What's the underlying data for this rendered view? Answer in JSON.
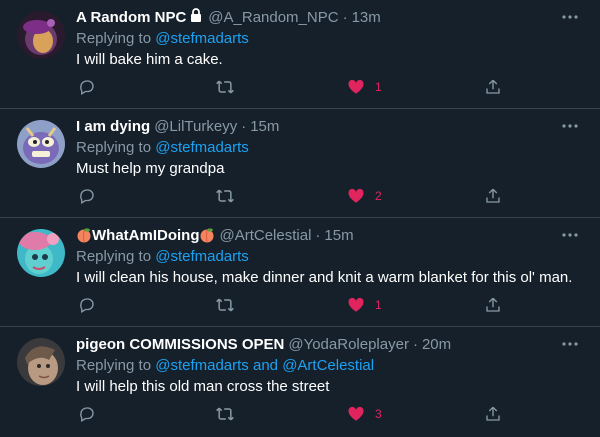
{
  "colors": {
    "background": "#15202b",
    "divider": "#38444d",
    "secondary_text": "#8899a6",
    "mention": "#1da1f2",
    "like_active": "#e0245e"
  },
  "replies": [
    {
      "display_name": "A Random NPC",
      "name_icon": "lock-icon",
      "handle": "@A_Random_NPC",
      "separator": "·",
      "time": "13m",
      "replying_prefix": "Replying to",
      "replying_to": "@stefmadarts",
      "replying_to_second": "",
      "text": "I will bake him a cake.",
      "like_count": "1",
      "liked": true
    },
    {
      "display_name": "I am dying",
      "handle": "@LilTurkeyy",
      "separator": "·",
      "time": "15m",
      "replying_prefix": "Replying to",
      "replying_to": "@stefmadarts",
      "replying_to_second": "",
      "text": "Must help my grandpa",
      "like_count": "2",
      "liked": true
    },
    {
      "display_name": "WhatAmIDoing",
      "name_icon": "peach-emoji-icon",
      "handle": "@ArtCelestial",
      "separator": "·",
      "time": "15m",
      "replying_prefix": "Replying to",
      "replying_to": "@stefmadarts",
      "replying_to_second": "",
      "text": "I will clean his house, make dinner and knit a warm blanket for this ol' man.",
      "like_count": "1",
      "liked": true
    },
    {
      "display_name": "pigeon COMMISSIONS OPEN",
      "handle": "@YodaRoleplayer",
      "separator": "·",
      "time": "20m",
      "replying_prefix": "Replying to",
      "replying_to": "@stefmadarts",
      "replying_joiner": "and",
      "replying_to_second": "@ArtCelestial",
      "text": "I will help this old man cross the street",
      "like_count": "3",
      "liked": true
    }
  ]
}
